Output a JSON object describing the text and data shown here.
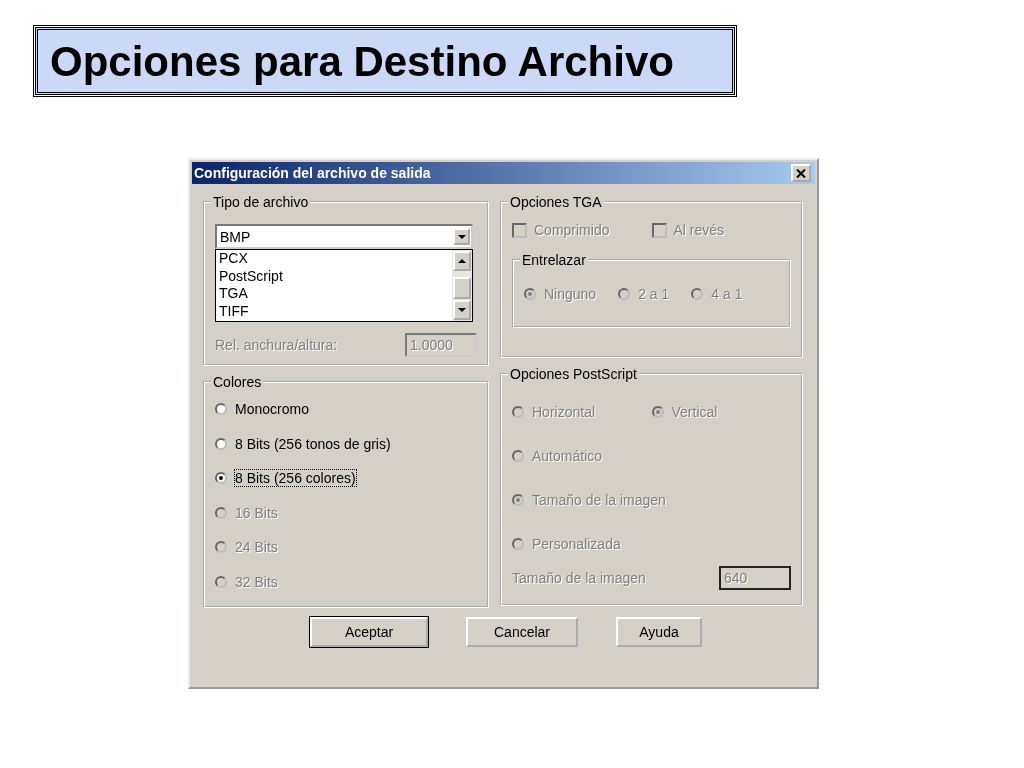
{
  "slide_title": "Opciones para Destino Archivo",
  "dialog": {
    "title": "Configuración del archivo de salida",
    "file_type": {
      "label": "Tipo de archivo",
      "combo": {
        "value": "BMP",
        "expanded": true,
        "options": [
          "PCX",
          "PostScript",
          "TGA",
          "TIFF"
        ]
      },
      "ratio": {
        "label": "Rel. anchura/altura:",
        "value": "1.0000",
        "disabled": true
      }
    },
    "colors": {
      "label": "Colores",
      "options": [
        {
          "label": "Monocromo",
          "selected": false,
          "disabled": false,
          "focused": false
        },
        {
          "label": "8 Bits (256 tonos de gris)",
          "selected": false,
          "disabled": false,
          "focused": false
        },
        {
          "label": "8 Bits (256 colores)",
          "selected": true,
          "disabled": false,
          "focused": true
        },
        {
          "label": "16 Bits",
          "selected": false,
          "disabled": true,
          "focused": false
        },
        {
          "label": "24 Bits",
          "selected": false,
          "disabled": true,
          "focused": false
        },
        {
          "label": "32 Bits",
          "selected": false,
          "disabled": true,
          "focused": false
        }
      ]
    },
    "tga": {
      "label": "Opciones TGA",
      "checkboxes": [
        {
          "label": "Comprimido",
          "checked": false,
          "disabled": true
        },
        {
          "label": "Al revés",
          "checked": false,
          "disabled": true
        }
      ],
      "interlace": {
        "label": "Entrelazar",
        "options": [
          {
            "label": "Ninguno",
            "selected": true,
            "disabled": true
          },
          {
            "label": "2 a 1",
            "selected": false,
            "disabled": true
          },
          {
            "label": "4 a 1",
            "selected": false,
            "disabled": true
          }
        ]
      }
    },
    "postscript": {
      "label": "Opciones PostScript",
      "rows": [
        [
          {
            "label": "Horizontal",
            "selected": false,
            "disabled": true
          },
          {
            "label": "Vertical",
            "selected": true,
            "disabled": true
          }
        ],
        [
          {
            "label": "Automático",
            "selected": false,
            "disabled": true
          }
        ],
        [
          {
            "label": "Tamaño de la imagen",
            "selected": true,
            "disabled": true
          }
        ],
        [
          {
            "label": "Personalizada",
            "selected": false,
            "disabled": true
          }
        ]
      ],
      "size": {
        "label": "Tamaño de la imagen",
        "value": "640",
        "disabled": true
      }
    },
    "buttons": [
      {
        "label": "Aceptar",
        "default": true
      },
      {
        "label": "Cancelar",
        "default": false
      },
      {
        "label": "Ayuda",
        "default": false
      }
    ]
  }
}
